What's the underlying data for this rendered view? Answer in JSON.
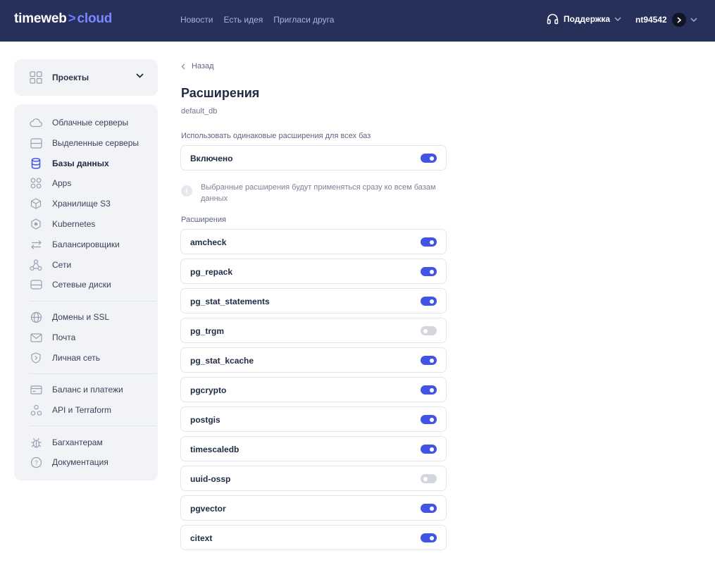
{
  "header": {
    "logo_main": "timeweb",
    "logo_sep": ">",
    "logo_accent": "cloud",
    "nav": [
      "Новости",
      "Есть идея",
      "Пригласи друга"
    ],
    "support_label": "Поддержка",
    "username": "nt94542"
  },
  "sidebar": {
    "projects_label": "Проекты",
    "groups": [
      {
        "items": [
          {
            "label": "Облачные серверы",
            "icon": "cloud-icon"
          },
          {
            "label": "Выделенные серверы",
            "icon": "server-icon"
          },
          {
            "label": "Базы данных",
            "icon": "database-icon",
            "active": true
          },
          {
            "label": "Apps",
            "icon": "apps-icon"
          },
          {
            "label": "Хранилище S3",
            "icon": "storage-cube-icon"
          },
          {
            "label": "Kubernetes",
            "icon": "kubernetes-icon"
          },
          {
            "label": "Балансировщики",
            "icon": "balancer-arrows-icon"
          },
          {
            "label": "Сети",
            "icon": "network-icon"
          },
          {
            "label": "Сетевые диски",
            "icon": "disk-icon"
          }
        ]
      },
      {
        "items": [
          {
            "label": "Домены и SSL",
            "icon": "globe-icon"
          },
          {
            "label": "Почта",
            "icon": "mail-icon"
          },
          {
            "label": "Личная сеть",
            "icon": "shield-icon"
          }
        ]
      },
      {
        "items": [
          {
            "label": "Баланс и платежи",
            "icon": "card-icon"
          },
          {
            "label": "API и Terraform",
            "icon": "api-icon"
          }
        ]
      },
      {
        "items": [
          {
            "label": "Багхантерам",
            "icon": "bug-icon"
          },
          {
            "label": "Документация",
            "icon": "help-icon"
          }
        ]
      }
    ]
  },
  "main": {
    "back_label": "Назад",
    "title": "Расширения",
    "db_name": "default_db",
    "same_ext_label": "Использовать одинаковые расширения для всех баз",
    "enabled_label": "Включено",
    "enabled_state": true,
    "info_text": "Выбранные расширения будут применяться сразу ко всем базам данных",
    "extensions_label": "Расширения",
    "extensions": [
      {
        "name": "amcheck",
        "enabled": true
      },
      {
        "name": "pg_repack",
        "enabled": true
      },
      {
        "name": "pg_stat_statements",
        "enabled": true
      },
      {
        "name": "pg_trgm",
        "enabled": false
      },
      {
        "name": "pg_stat_kcache",
        "enabled": true
      },
      {
        "name": "pgcrypto",
        "enabled": true
      },
      {
        "name": "postgis",
        "enabled": true
      },
      {
        "name": "timescaledb",
        "enabled": true
      },
      {
        "name": "uuid-ossp",
        "enabled": false
      },
      {
        "name": "pgvector",
        "enabled": true
      },
      {
        "name": "citext",
        "enabled": true
      }
    ]
  },
  "colors": {
    "header_bg": "#26305a",
    "accent": "#4254e6",
    "toggle_off": "#d4d6de",
    "sidebar_bg": "#f2f3f6"
  }
}
